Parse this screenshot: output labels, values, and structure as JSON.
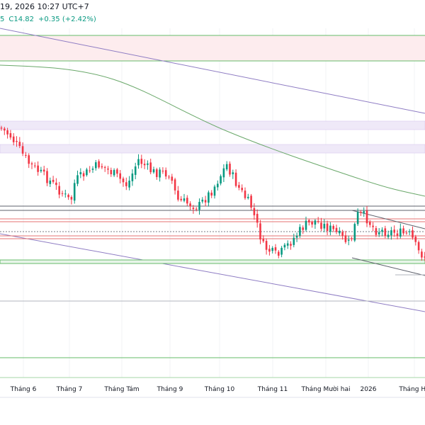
{
  "header": {
    "datetime": "19, 2026 10:27 UTC+7",
    "ohlc_fragment": "5",
    "close": "C14.82",
    "change": "+0.35 (+2.42%)"
  },
  "colors": {
    "up": "#089981",
    "down": "#f23645",
    "ma": "#4caf50",
    "trend": "#7e57c2",
    "zone_red": "#fce8ea",
    "zone_purple": "#efe9f8"
  },
  "chart_data": {
    "type": "candlestick",
    "x_tick_labels": [
      "Tháng 6",
      "Tháng 7",
      "Tháng Tám",
      "Tháng 9",
      "Tháng 10",
      "Tháng 11",
      "Tháng Mười hai",
      "2026",
      "Tháng Ha"
    ],
    "last_close": 14.82,
    "change": 0.35,
    "change_percent": 2.42,
    "grid": true
  }
}
